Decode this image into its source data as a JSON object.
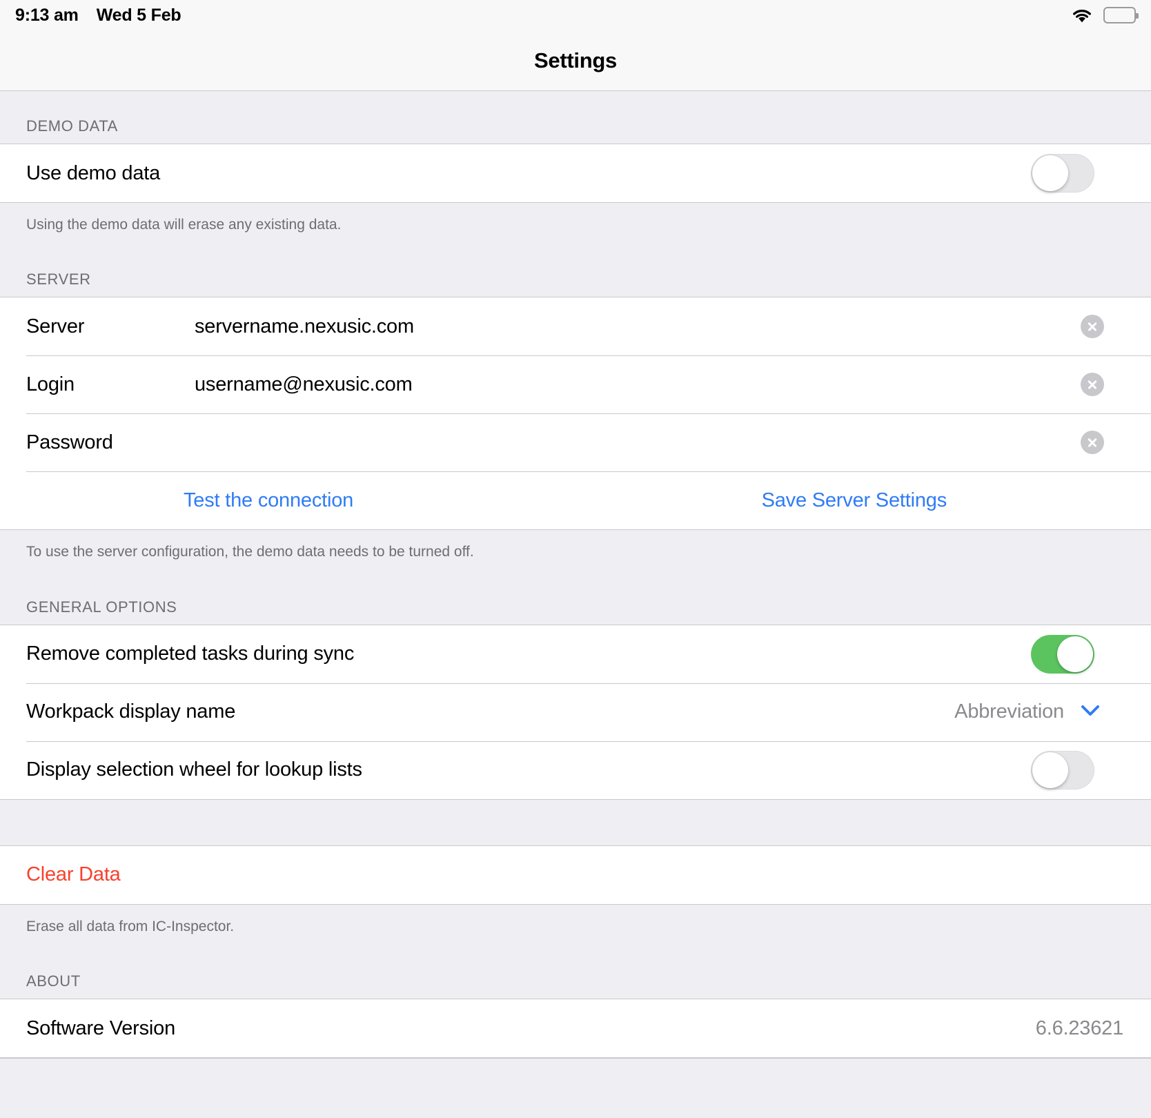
{
  "status_bar": {
    "time": "9:13 am",
    "date": "Wed 5 Feb",
    "wifi_icon": "wifi-icon",
    "battery_icon": "battery-icon",
    "battery_level_percent": 70
  },
  "nav": {
    "title": "Settings"
  },
  "sections": {
    "demo_data": {
      "header": "DEMO DATA",
      "row_label": "Use demo data",
      "toggle_state": "off",
      "footer": "Using the demo data will erase any existing data."
    },
    "server": {
      "header": "SERVER",
      "fields": [
        {
          "label": "Server",
          "value": "servername.nexusic.com",
          "clear_icon": "clear-circle-icon"
        },
        {
          "label": "Login",
          "value": "username@nexusic.com",
          "clear_icon": "clear-circle-icon"
        },
        {
          "label": "Password",
          "value": "",
          "clear_icon": "clear-circle-icon"
        }
      ],
      "test_button": "Test the connection",
      "save_button": "Save Server Settings",
      "footer": "To use the server configuration, the demo data needs to be turned off."
    },
    "general_options": {
      "header": "GENERAL OPTIONS",
      "remove_completed_label": "Remove completed tasks during sync",
      "remove_completed_state": "on",
      "workpack_label": "Workpack display name",
      "workpack_value": "Abbreviation",
      "workpack_chevron": "chevron-down-icon",
      "selection_wheel_label": "Display selection wheel for lookup lists",
      "selection_wheel_state": "off"
    },
    "clear_data": {
      "label": "Clear Data",
      "footer": "Erase all data from IC-Inspector."
    },
    "about": {
      "header": "ABOUT",
      "version_label": "Software Version",
      "version_value": "6.6.23621"
    }
  },
  "colors": {
    "accent_blue": "#2f7cf6",
    "destructive_red": "#f8412c",
    "toggle_on_green": "#5bc45f",
    "toggle_off_gray": "#e6e6e8",
    "secondary_text": "#6d6d72",
    "group_background": "#eeeef3"
  }
}
